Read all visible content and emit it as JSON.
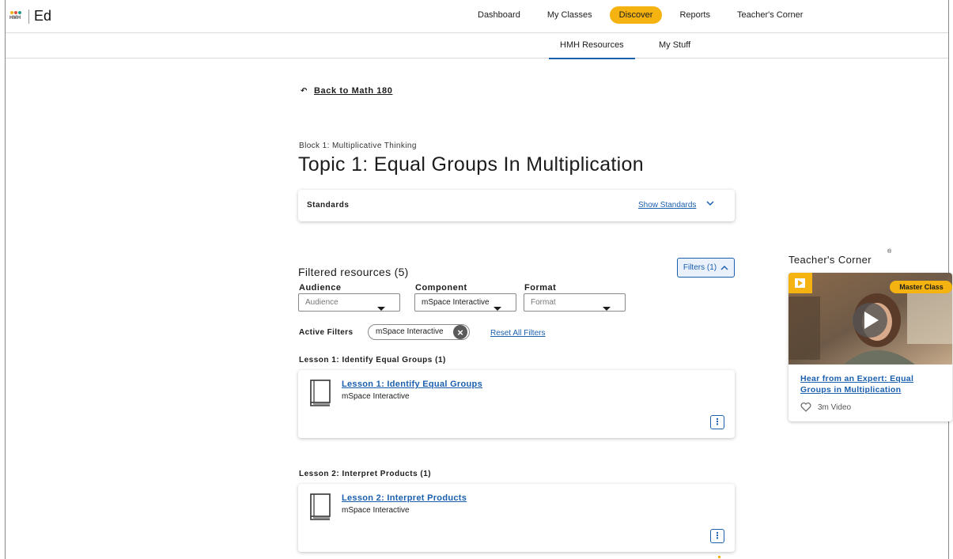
{
  "app": {
    "logo_text": "HMH",
    "name": "Ed",
    "logo_colors": [
      "#f5b311",
      "#e0533d",
      "#1a9a8a"
    ]
  },
  "nav": {
    "items": [
      {
        "label": "Dashboard"
      },
      {
        "label": "My Classes"
      },
      {
        "label": "Discover"
      },
      {
        "label": "Reports"
      },
      {
        "label": "Teacher's Corner"
      }
    ],
    "active": "Discover"
  },
  "subnav": {
    "tabs": [
      {
        "label": "HMH Resources"
      },
      {
        "label": "My Stuff"
      }
    ],
    "active": "HMH Resources"
  },
  "page": {
    "back_label": "Back to Math 180",
    "block_label": "Block 1: Multiplicative Thinking",
    "title": "Topic 1: Equal Groups In Multiplication"
  },
  "standards": {
    "label": "Standards",
    "show_label": "Show Standards"
  },
  "filters": {
    "results_title": "Filtered resources (5)",
    "button_label": "Filters (1)",
    "audience": {
      "label": "Audience",
      "value": "Audience"
    },
    "component": {
      "label": "Component",
      "value": "mSpace Interactive"
    },
    "format": {
      "label": "Format",
      "value": "Format"
    },
    "active_label": "Active Filters",
    "active_chip": "mSpace Interactive",
    "reset_label": "Reset All Filters"
  },
  "lessons": [
    {
      "group": "Lesson 1: Identify Equal Groups (1)",
      "title": "Lesson 1: Identify Equal Groups",
      "type": "mSpace Interactive"
    },
    {
      "group": "Lesson 2: Interpret Products (1)",
      "title": "Lesson 2: Interpret Products",
      "type": "mSpace Interactive"
    }
  ],
  "teachers_corner": {
    "title": "Teacher's Corner",
    "reg_mark": "®",
    "badge": "Master Class",
    "link": "Hear from an Expert: Equal Groups in Multiplication",
    "meta": "3m Video"
  },
  "colors": {
    "accent": "#f5b311",
    "link": "#1a5fae"
  }
}
